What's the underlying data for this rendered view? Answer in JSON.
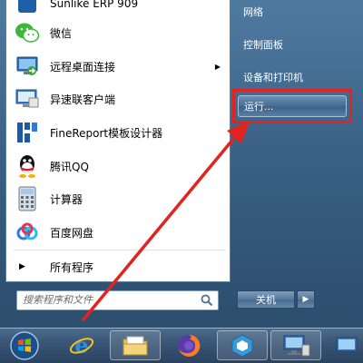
{
  "left_items": [
    {
      "label": "Sunlike ERP 909",
      "icon": "sunlike-erp-icon"
    },
    {
      "label": "微信",
      "icon": "wechat-icon"
    },
    {
      "label": "远程桌面连接",
      "icon": "remote-desktop-icon",
      "has_submenu": true
    },
    {
      "label": "异速联客户端",
      "icon": "gnway-client-icon"
    },
    {
      "label": "FineReport模板设计器",
      "icon": "finereport-icon"
    },
    {
      "label": "腾讯QQ",
      "icon": "qq-icon"
    },
    {
      "label": "计算器",
      "icon": "calculator-icon"
    },
    {
      "label": "百度网盘",
      "icon": "baidu-netdisk-icon"
    }
  ],
  "all_programs": "所有程序",
  "search": {
    "placeholder": "搜索程序和文件"
  },
  "right_items": [
    {
      "label": "网络"
    },
    {
      "label": "控制面板"
    },
    {
      "label": "设备和打印机"
    },
    {
      "label": "运行..."
    }
  ],
  "shutdown_label": "关机",
  "taskbar": [
    "start-orb-icon",
    "internet-explorer-icon",
    "file-explorer-icon",
    "firefox-icon",
    "app-icon",
    "network-computer-icon"
  ],
  "colors": {
    "highlight_box": "#e3231f",
    "arrow": "#e3231f"
  }
}
